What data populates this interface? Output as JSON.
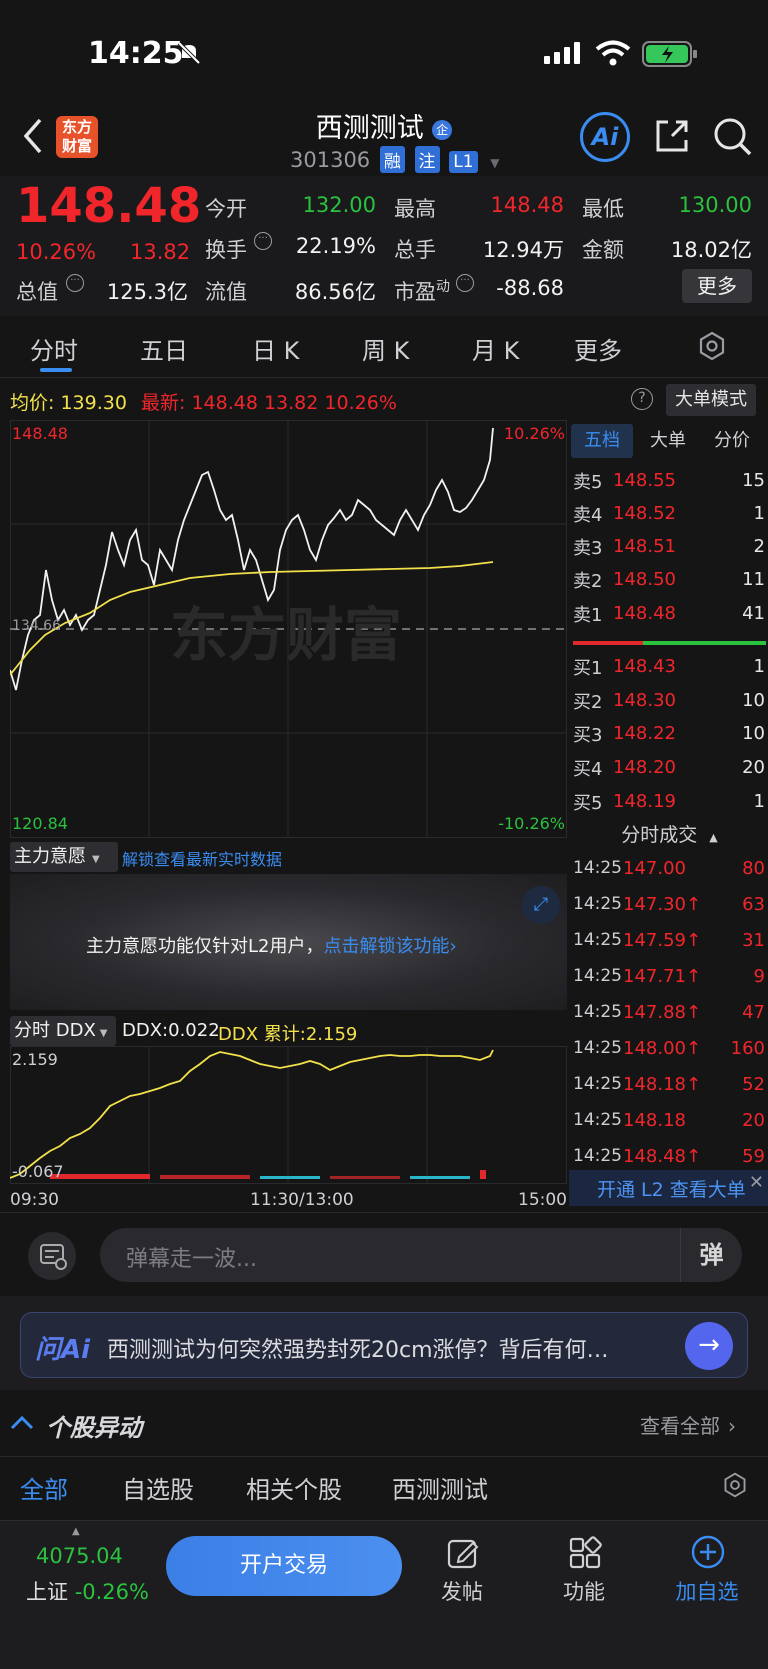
{
  "status": {
    "time": "14:25"
  },
  "header": {
    "stock_name": "西测测试",
    "stock_code": "301306",
    "tags": [
      "融",
      "注",
      "L1"
    ],
    "logo_text_top": "东方",
    "logo_text_bottom": "财富",
    "ai_label": "Ai"
  },
  "quote": {
    "price": "148.48",
    "change_pct": "10.26%",
    "change_amt": "13.82",
    "open_label": "今开",
    "open_value": "132.00",
    "high_label": "最高",
    "high_value": "148.48",
    "low_label": "最低",
    "low_value": "130.00",
    "turnover_label": "换手",
    "turnover_value": "22.19%",
    "volume_label": "总手",
    "volume_value": "12.94万",
    "amount_label": "金额",
    "amount_value": "18.02亿",
    "mktcap_label": "总值",
    "mktcap_value": "125.3亿",
    "float_label": "流值",
    "float_value": "86.56亿",
    "pe_label": "市盈",
    "pe_sup": "动",
    "pe_value": "-88.68",
    "more_label": "更多"
  },
  "tabs": [
    "分时",
    "五日",
    "日 K",
    "周 K",
    "月 K",
    "更多"
  ],
  "chart_info": {
    "avg_label": "均价:",
    "avg_value": "139.30",
    "latest_label": "最新:",
    "latest_value": "148.48",
    "latest_change": "13.82",
    "latest_pct": "10.26%",
    "mode_label": "大单模式",
    "top_price": "148.48",
    "bottom_price": "120.84",
    "mid_price": "134.66",
    "top_pct": "10.26%",
    "bottom_pct": "-10.26%",
    "watermark": "东方财富"
  },
  "chart_data": {
    "type": "line",
    "series": [],
    "ylim": [
      120.84,
      148.48
    ],
    "ymid": 134.66
  },
  "orderbook": {
    "tabs": [
      "五档",
      "大单",
      "分价"
    ],
    "sells": [
      {
        "label": "卖5",
        "price": "148.55",
        "vol": "15"
      },
      {
        "label": "卖4",
        "price": "148.52",
        "vol": "1"
      },
      {
        "label": "卖3",
        "price": "148.51",
        "vol": "2"
      },
      {
        "label": "卖2",
        "price": "148.50",
        "vol": "11"
      },
      {
        "label": "卖1",
        "price": "148.48",
        "vol": "41"
      }
    ],
    "buys": [
      {
        "label": "买1",
        "price": "148.43",
        "vol": "1"
      },
      {
        "label": "买2",
        "price": "148.30",
        "vol": "10"
      },
      {
        "label": "买3",
        "price": "148.22",
        "vol": "10"
      },
      {
        "label": "买4",
        "price": "148.20",
        "vol": "20"
      },
      {
        "label": "买5",
        "price": "148.19",
        "vol": "1"
      }
    ],
    "trades_title": "分时成交",
    "trades": [
      {
        "t": "14:25",
        "p": "147.00",
        "v": "80"
      },
      {
        "t": "14:25",
        "p": "147.30↑",
        "v": "63"
      },
      {
        "t": "14:25",
        "p": "147.59↑",
        "v": "31"
      },
      {
        "t": "14:25",
        "p": "147.71↑",
        "v": "9"
      },
      {
        "t": "14:25",
        "p": "147.88↑",
        "v": "47"
      },
      {
        "t": "14:25",
        "p": "148.00↑",
        "v": "160"
      },
      {
        "t": "14:25",
        "p": "148.18↑",
        "v": "52"
      },
      {
        "t": "14:25",
        "p": "148.18",
        "v": "20"
      },
      {
        "t": "14:25",
        "p": "148.48↑",
        "v": "59"
      }
    ],
    "l2_banner": "开通 L2 查看大单"
  },
  "main_force": {
    "label": "主力意愿",
    "link": "解锁查看最新实时数据",
    "notice": "主力意愿功能仅针对L2用户，",
    "notice_link": "点击解锁该功能"
  },
  "ddx": {
    "label": "分时 DDX",
    "ddx_value": "DDX:0.022",
    "ddx_cum": "DDX 累计:2.159",
    "top": "2.159",
    "bottom": "-0.067"
  },
  "time_axis": [
    "09:30",
    "11:30/13:00",
    "15:00"
  ],
  "danmu": {
    "placeholder": "弹幕走一波...",
    "btn": "弹"
  },
  "ask_ai": {
    "brand": "问Ai",
    "question": "西测测试为何突然强势封死20cm涨停？背后有何…"
  },
  "news": {
    "title": "个股异动",
    "view_all": "查看全部",
    "tabs": [
      "全部",
      "自选股",
      "相关个股",
      "西测测试"
    ]
  },
  "bottom_bar": {
    "index_value": "4075.04",
    "index_name": "上证",
    "index_change": "-0.26%",
    "trade_btn": "开户交易",
    "items": [
      "发帖",
      "功能",
      "加自选"
    ]
  }
}
